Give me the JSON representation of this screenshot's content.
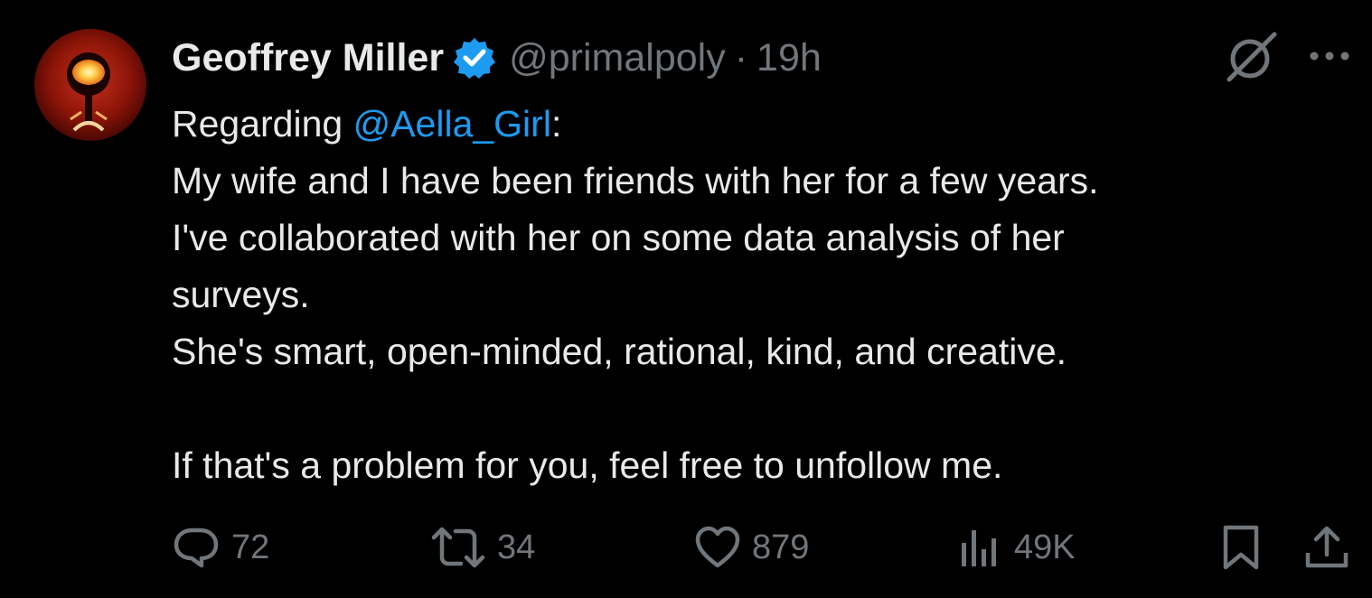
{
  "author": {
    "display_name": "Geoffrey Miller",
    "handle": "@primalpoly",
    "separator": "·",
    "time": "19h",
    "verified": true
  },
  "tweet": {
    "intro_prefix": "Regarding ",
    "mention": "@Aella_Girl",
    "intro_suffix": ":",
    "lines": [
      "My wife and I have been friends with her for a few years.",
      "I've collaborated with her on some data analysis of her",
      "surveys.",
      "She's smart, open-minded, rational, kind, and creative."
    ],
    "closing": "If that's a problem for you, feel free to unfollow me."
  },
  "actions": {
    "replies": "72",
    "reposts": "34",
    "likes": "879",
    "views": "49K"
  },
  "icons": {
    "reply": "reply-icon",
    "repost": "repost-icon",
    "like": "heart-icon",
    "views": "views-icon",
    "bookmark": "bookmark-icon",
    "share": "share-icon",
    "grok": "grok-icon",
    "more": "more-icon",
    "verified": "verified-badge-icon"
  },
  "colors": {
    "background": "#000000",
    "text": "#e7e9ea",
    "secondary": "#71767b",
    "accent": "#1d9bf0"
  }
}
